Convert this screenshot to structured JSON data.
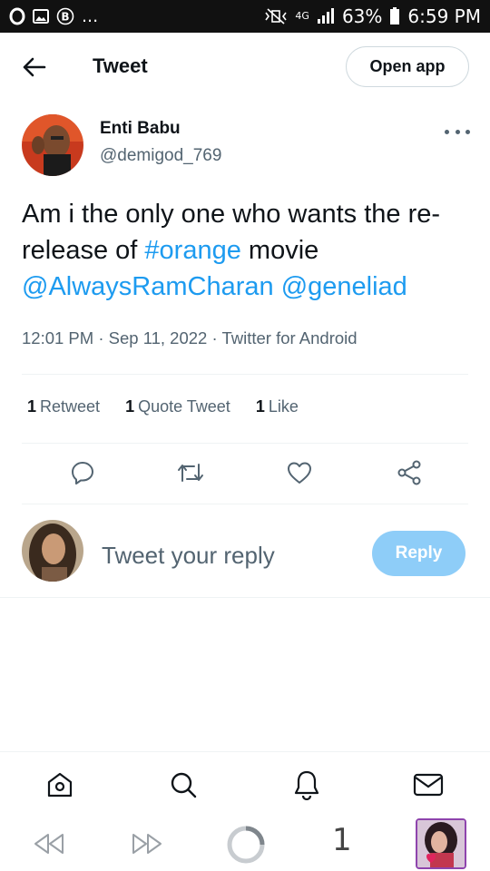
{
  "status_bar": {
    "left_icons": [
      "opera-icon",
      "image-icon",
      "b-icon"
    ],
    "ellipsis": "...",
    "network": "4G",
    "battery_percent": "63%",
    "time": "6:59 PM"
  },
  "header": {
    "back_icon": "arrow-left-icon",
    "title": "Tweet",
    "open_app_label": "Open app"
  },
  "author": {
    "name": "Enti Babu",
    "handle": "@demigod_769"
  },
  "tweet": {
    "text_part1": "Am i the only one who wants the re-release of ",
    "hashtag": "#orange",
    "text_part2": " movie",
    "mention1": "@AlwaysRamCharan",
    "mention2": "@geneliad",
    "time": "12:01 PM",
    "sep1": " · ",
    "date": "Sep 11, 2022",
    "sep2": " · ",
    "source": "Twitter for Android"
  },
  "stats": [
    {
      "count": "1",
      "label": "Retweet"
    },
    {
      "count": "1",
      "label": "Quote Tweet"
    },
    {
      "count": "1",
      "label": "Like"
    }
  ],
  "actions": [
    "reply-icon",
    "retweet-icon",
    "like-icon",
    "share-icon"
  ],
  "reply": {
    "placeholder": "Tweet your reply",
    "button_label": "Reply"
  },
  "bottom_nav": [
    "home-icon",
    "search-icon",
    "notifications-icon",
    "messages-icon"
  ],
  "browser_bar": {
    "tab_count": "1"
  },
  "colors": {
    "accent": "#1d9bf0",
    "reply_button": "#8ecdf8",
    "secondary_text": "#536471",
    "divider": "#eff3f4"
  }
}
